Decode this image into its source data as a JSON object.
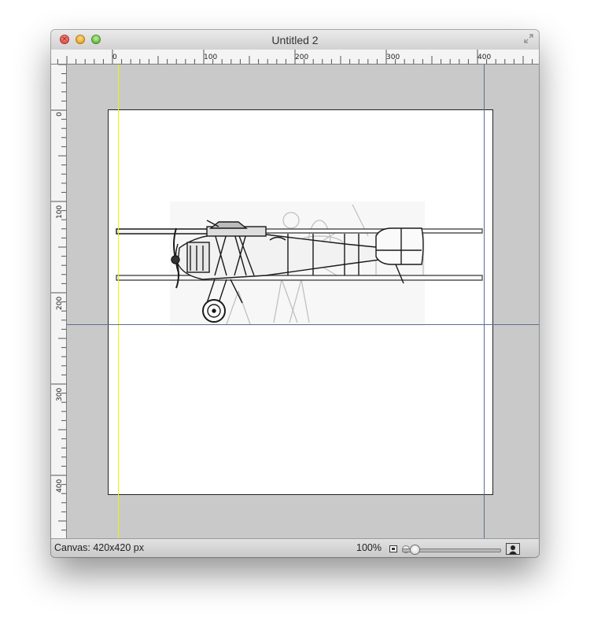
{
  "window": {
    "title": "Untitled 2"
  },
  "rulers": {
    "horizontal_labels": [
      "0",
      "100",
      "200",
      "300",
      "400"
    ],
    "vertical_labels": [
      "0",
      "100",
      "200",
      "300",
      "400"
    ]
  },
  "canvas": {
    "label": "Canvas: 420x420 px"
  },
  "zoom": {
    "percent": "100%"
  },
  "colors": {
    "guide_yellow": "#f2f200",
    "guide_blue": "#5c6f8f",
    "workspace": "#c9c9c9"
  },
  "icons": [
    "close-icon",
    "minimize-icon",
    "zoom-icon",
    "fullscreen-icon",
    "fit-to-window-icon",
    "actual-size-icon"
  ]
}
